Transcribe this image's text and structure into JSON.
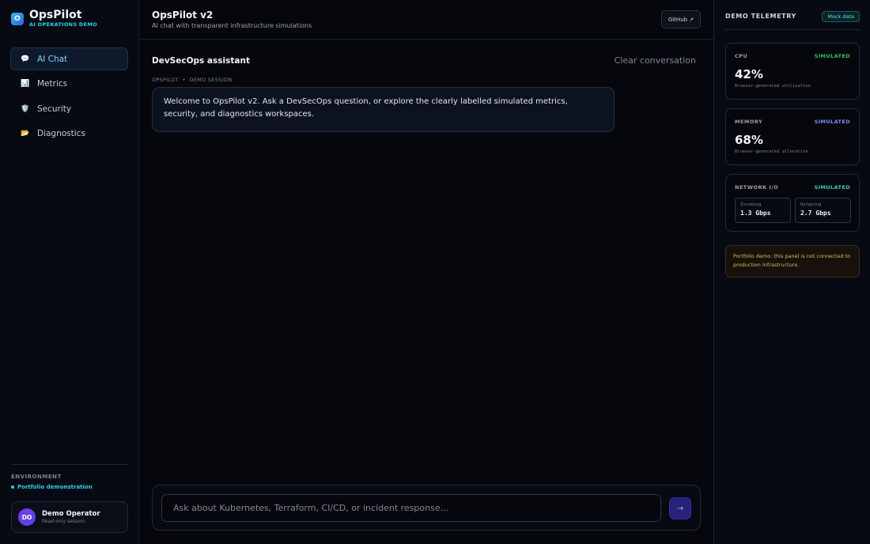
{
  "brand": {
    "logo_letter": "O",
    "name": "OpsPilot",
    "subtitle": "AI OPERATIONS DEMO"
  },
  "sidebar": {
    "items": [
      {
        "label": "AI Chat",
        "icon": "speech-bubble-icon",
        "glyph": "💬",
        "active": true
      },
      {
        "label": "Metrics",
        "icon": "bar-chart-icon",
        "glyph": "📊",
        "active": false
      },
      {
        "label": "Security",
        "icon": "shield-icon",
        "glyph": "🛡️",
        "active": false
      },
      {
        "label": "Diagnostics",
        "icon": "folder-icon",
        "glyph": "📂",
        "active": false
      }
    ],
    "environment_label": "ENVIRONMENT",
    "environment_value": "Portfolio demonstration",
    "user": {
      "initials": "DO",
      "name": "Demo Operator",
      "role": "Read-only session"
    }
  },
  "header": {
    "title": "OpsPilot v2",
    "subtitle": "AI chat with transparent infrastructure simulations",
    "github_label": "GitHub ↗"
  },
  "chat": {
    "title": "DevSecOps assistant",
    "clear_label": "Clear conversation",
    "message_meta": "OPSPILOT  •  DEMO SESSION",
    "message_text": "Welcome to OpsPilot v2. Ask a DevSecOps question, or explore the clearly labelled simulated metrics, security, and diagnostics workspaces.",
    "input_placeholder": "Ask about Kubernetes, Terraform, CI/CD, or incident response...",
    "send_glyph": "→"
  },
  "telemetry": {
    "title": "DEMO TELEMETRY",
    "badge": "Mock data",
    "cpu": {
      "label": "CPU",
      "status": "SIMULATED",
      "status_color": "#22c55e",
      "value": "42%",
      "note": "Browser-generated utilization"
    },
    "memory": {
      "label": "MEMORY",
      "status": "SIMULATED",
      "status_color": "#818cf8",
      "value": "68%",
      "note": "Browser-generated allocation"
    },
    "network": {
      "label": "NETWORK I/O",
      "status": "SIMULATED",
      "status_color": "#2dd4bf",
      "incoming_label": "Incoming",
      "incoming_value": "1.3 Gbps",
      "outgoing_label": "Outgoing",
      "outgoing_value": "2.7 Gbps"
    },
    "notice": "Portfolio demo: this panel is not connected to production infrastructure."
  },
  "colors": {
    "accent": "#22d3ee",
    "background": "#05070d",
    "warning": "#e3b663"
  }
}
